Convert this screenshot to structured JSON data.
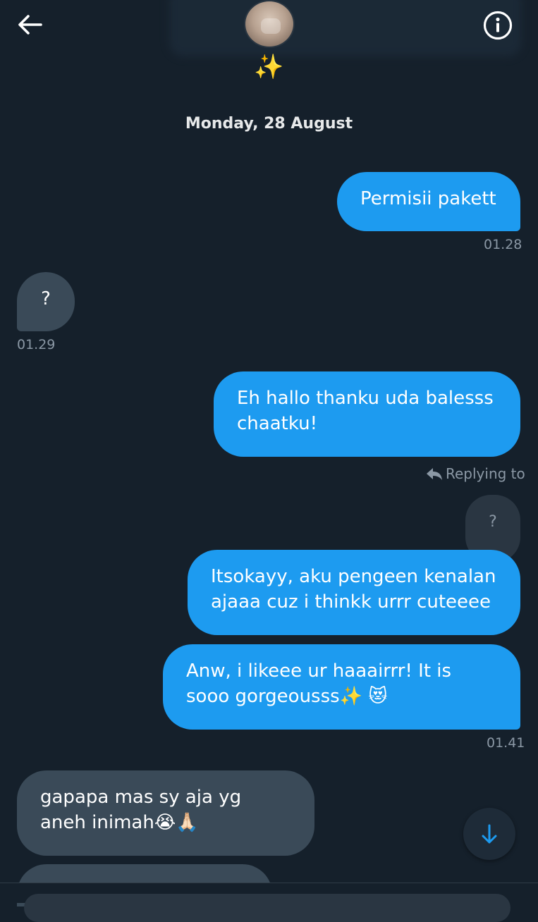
{
  "header": {
    "back_icon": "arrow-left-icon",
    "info_icon": "info-circle-icon",
    "status_emoji": "✨"
  },
  "date_separator": "Monday, 28 August",
  "messages": [
    {
      "text": "Permisii pakett",
      "time": "01.28"
    },
    {
      "text": "?",
      "time": "01.29"
    },
    {
      "text": "Eh hallo thanku uda balesss chaatku!"
    },
    {
      "replying_label": "Replying to",
      "reply_quote": "?"
    },
    {
      "text": "Itsokayy, aku pengeen kenalan ajaaa cuz i thinkk urrr cuteeee"
    },
    {
      "text": "Anw, i likeee ur haaairrr! It is sooo gorgeousss✨ 😻",
      "time": "01.41"
    },
    {
      "text": "gapapa mas sy aja yg aneh inimah😭🙏🏻"
    }
  ],
  "colors": {
    "background": "#15202b",
    "outgoing": "#1d9bf0",
    "incoming": "#3a4a58",
    "muted": "#8b98a5"
  }
}
